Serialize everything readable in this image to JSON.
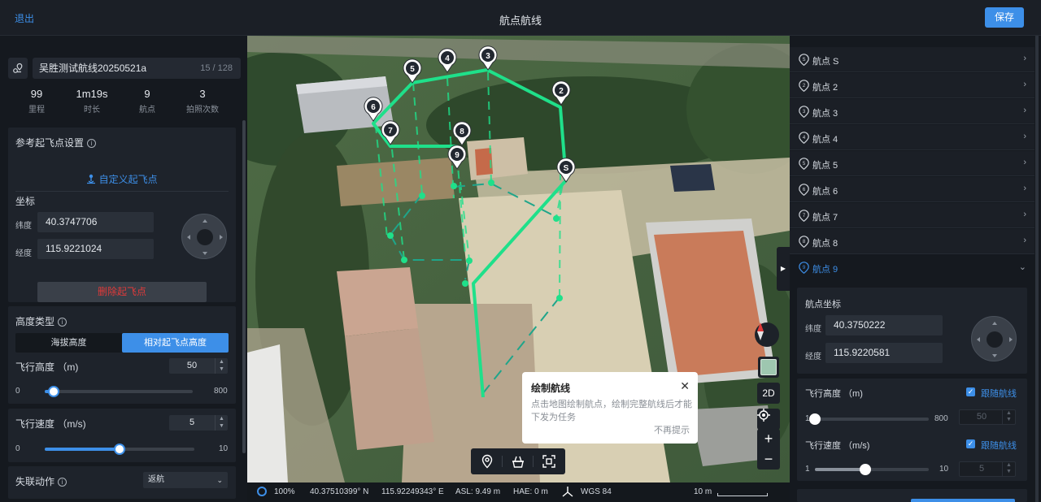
{
  "header": {
    "exit_label": "退出",
    "title": "航点航线",
    "save_label": "保存"
  },
  "route": {
    "name": "吴胜测试航线20250521a",
    "char_count": "15 / 128"
  },
  "stats": [
    {
      "value": "99",
      "label": "里程"
    },
    {
      "value": "1m19s",
      "label": "时长"
    },
    {
      "value": "9",
      "label": "航点"
    },
    {
      "value": "3",
      "label": "拍照次数"
    }
  ],
  "takeoff": {
    "title": "参考起飞点设置",
    "custom_label": "自定义起飞点",
    "coord_title": "坐标",
    "lat_label": "纬度",
    "lat_value": "40.3747706",
    "lng_label": "经度",
    "lng_value": "115.9221024",
    "delete_label": "删除起飞点"
  },
  "altitude_type": {
    "title": "高度类型",
    "option_a": "海拔高度",
    "option_b": "相对起飞点高度",
    "selected": "相对起飞点高度"
  },
  "flight_height": {
    "label": "飞行高度 （m)",
    "value": "50",
    "min": "0",
    "max": "800",
    "fraction": 0.0625
  },
  "flight_speed": {
    "label": "飞行速度 （m/s)",
    "value": "5",
    "min": "0",
    "max": "10",
    "fraction": 0.5
  },
  "lost_action": {
    "label": "失联动作",
    "value": "返航"
  },
  "map": {
    "tip_title": "绘制航线",
    "tip_desc": "点击地图绘制航点，绘制完整航线后才能下发为任务",
    "tip_dismiss": "不再提示",
    "mode_2d": "2D",
    "zoom_in": "+",
    "zoom_out": "−",
    "waypoint_labels": [
      "S",
      "2",
      "3",
      "4",
      "5",
      "6",
      "7",
      "8",
      "9"
    ]
  },
  "status": {
    "zoom": "100%",
    "lat": "40.37510399° N",
    "lng": "115.92249343° E",
    "asl": "ASL: 9.49 m",
    "hae": "HAE: 0 m",
    "datum": "WGS 84",
    "scale": "10 m"
  },
  "waypoints": [
    {
      "label": "航点 S",
      "badge": "S"
    },
    {
      "label": "航点 2",
      "badge": "2"
    },
    {
      "label": "航点 3",
      "badge": "3"
    },
    {
      "label": "航点 4",
      "badge": "4"
    },
    {
      "label": "航点 5",
      "badge": "5"
    },
    {
      "label": "航点 6",
      "badge": "6"
    },
    {
      "label": "航点 7",
      "badge": "7"
    },
    {
      "label": "航点 8",
      "badge": "8"
    },
    {
      "label": "航点 9",
      "badge": "9",
      "active": true
    }
  ],
  "wp_detail": {
    "coord_title": "航点坐标",
    "lat_label": "纬度",
    "lat_value": "40.3750222",
    "lng_label": "经度",
    "lng_value": "115.9220581",
    "height_label": "飞行高度 （m)",
    "height_follow": "跟随航线",
    "height_min": "1",
    "height_max": "800",
    "height_value": "50",
    "height_fraction": 0.0,
    "speed_label": "飞行速度 （m/s)",
    "speed_follow": "跟随航线",
    "speed_min": "1",
    "speed_max": "10",
    "speed_value": "5",
    "speed_fraction": 0.444
  },
  "colors": {
    "accent": "#3d8fe8",
    "route": "#1fe08a",
    "danger": "#e03a3a"
  }
}
